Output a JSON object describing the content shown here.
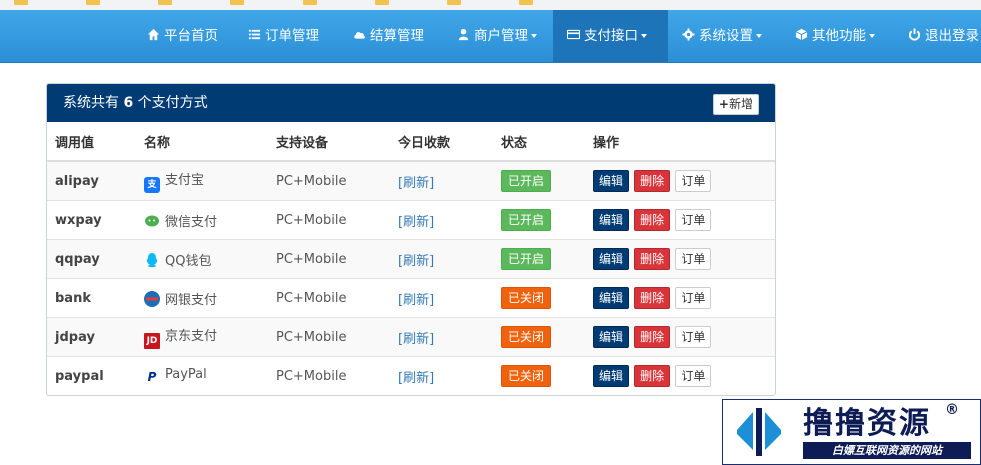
{
  "nav": {
    "items": [
      {
        "label": "平台首页",
        "icon": "home-icon",
        "dropdown": false
      },
      {
        "label": "订单管理",
        "icon": "list-icon",
        "dropdown": false
      },
      {
        "label": "结算管理",
        "icon": "cloud-icon",
        "dropdown": false
      },
      {
        "label": "商户管理",
        "icon": "user-icon",
        "dropdown": true
      },
      {
        "label": "支付接口",
        "icon": "card-icon",
        "dropdown": true,
        "active": true
      },
      {
        "label": "系统设置",
        "icon": "gear-icon",
        "dropdown": true
      },
      {
        "label": "其他功能",
        "icon": "cube-icon",
        "dropdown": true
      },
      {
        "label": "退出登录",
        "icon": "power-icon",
        "dropdown": false
      }
    ]
  },
  "panel": {
    "title_prefix": "系统共有",
    "count": "6",
    "title_suffix": "个支付方式",
    "add_label": "新增"
  },
  "table": {
    "headers": [
      "调用值",
      "名称",
      "支持设备",
      "今日收款",
      "状态",
      "操作"
    ],
    "rows": [
      {
        "code": "alipay",
        "name": "支付宝",
        "logo": "alipay-logo-icon",
        "device": "PC+Mobile",
        "today": "[刷新]",
        "status": "已开启",
        "enabled": true
      },
      {
        "code": "wxpay",
        "name": "微信支付",
        "logo": "wechat-logo-icon",
        "device": "PC+Mobile",
        "today": "[刷新]",
        "status": "已开启",
        "enabled": true
      },
      {
        "code": "qqpay",
        "name": "QQ钱包",
        "logo": "qq-logo-icon",
        "device": "PC+Mobile",
        "today": "[刷新]",
        "status": "已开启",
        "enabled": true
      },
      {
        "code": "bank",
        "name": "网银支付",
        "logo": "unionpay-logo-icon",
        "device": "PC+Mobile",
        "today": "[刷新]",
        "status": "已关闭",
        "enabled": false
      },
      {
        "code": "jdpay",
        "name": "京东支付",
        "logo": "jd-logo-icon",
        "device": "PC+Mobile",
        "today": "[刷新]",
        "status": "已关闭",
        "enabled": false
      },
      {
        "code": "paypal",
        "name": "PayPal",
        "logo": "paypal-logo-icon",
        "device": "PC+Mobile",
        "today": "[刷新]",
        "status": "已关闭",
        "enabled": false
      }
    ],
    "actions": {
      "edit": "编辑",
      "delete": "删除",
      "orders": "订单"
    }
  },
  "watermark": {
    "title": "撸撸资源",
    "subtitle": "白嫖互联网资源的网站",
    "reg": "®"
  },
  "colors": {
    "navbar": "#2c8fd6",
    "nav_active": "#1e74b8",
    "panel_head": "#003b73",
    "status_on": "#5cb85c",
    "status_off": "#f0620e",
    "edit": "#003b73",
    "delete": "#d9343a",
    "link": "#337ab7"
  }
}
